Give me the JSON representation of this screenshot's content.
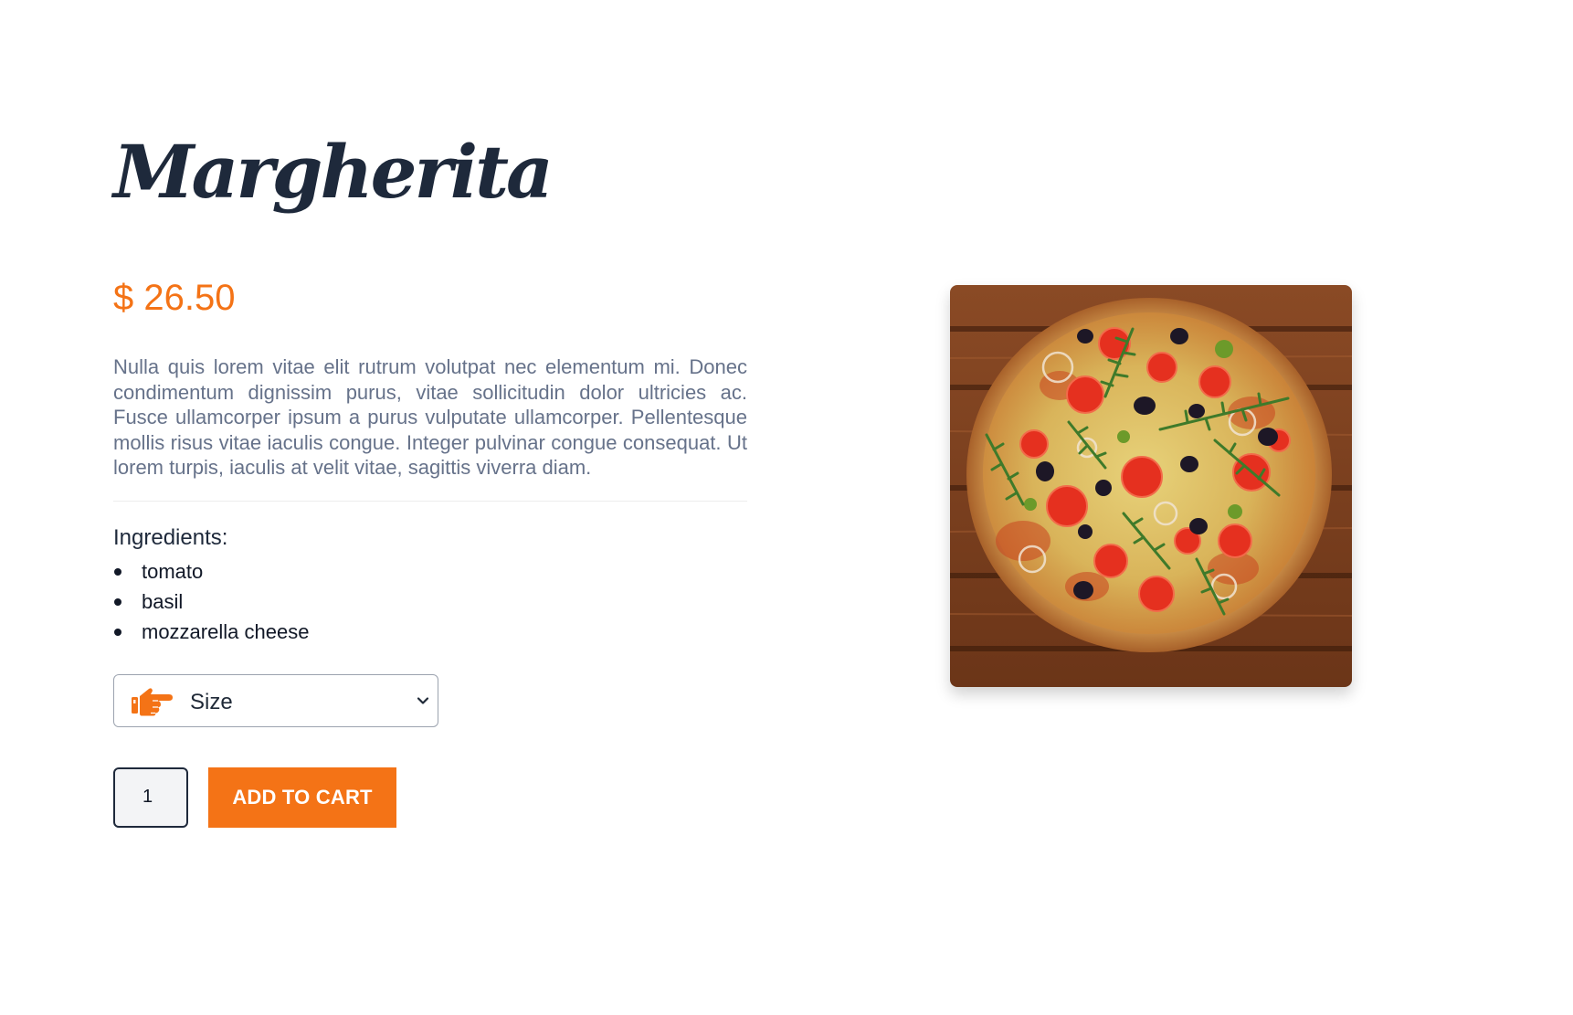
{
  "product": {
    "name": "Margherita",
    "price": "$ 26.50",
    "description": "Nulla quis lorem vitae elit rutrum volutpat nec elementum mi. Donec condimentum dignissim purus, vitae sollicitudin dolor ultricies ac. Fusce ullamcorper ipsum a purus vulputate ullamcorper. Pellentesque mollis risus vitae iaculis congue. Integer pulvinar congue consequat. Ut lorem turpis, iaculis at velit vitae, sagittis viverra diam.",
    "ingredients_heading": "Ingredients:",
    "ingredients": [
      "tomato",
      "basil",
      "mozzarella cheese"
    ],
    "image_alt": "margherita-pizza-photo"
  },
  "size_select": {
    "selected": "Size",
    "icon": "pointing-hand-icon"
  },
  "cart": {
    "quantity": "1",
    "add_label": "ADD TO CART"
  },
  "colors": {
    "accent": "#f47316",
    "title": "#1e293b",
    "text_muted": "#66728a"
  }
}
